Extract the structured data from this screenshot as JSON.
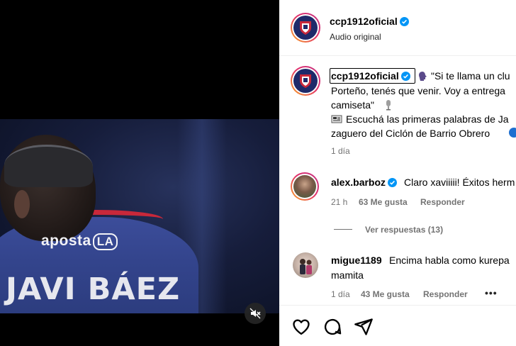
{
  "media": {
    "sponsor_text": "aposta",
    "sponsor_box_text": "LA",
    "jersey_name": "JAVI BÁEZ",
    "mute_icon": "speaker-muted-icon"
  },
  "header": {
    "username": "ccp1912oficial",
    "audio_label": "Audio original"
  },
  "caption": {
    "username": "ccp1912oficial",
    "line1": "\"Si te llama un clu",
    "line2": "Porteño, tenés que venir. Voy a entrega",
    "line3": "camiseta\"",
    "line4": "Escuchá las primeras palabras de Ja",
    "line5": "zaguero del Ciclón de Barrio Obrero",
    "time": "1 día"
  },
  "comments": [
    {
      "username": "alex.barboz",
      "text": "Claro xaviiiii! Éxitos herm",
      "time": "21 h",
      "likes": "63 Me gusta",
      "reply": "Responder",
      "view_replies": "Ver respuestas (13)"
    },
    {
      "username": "migue1189",
      "text": "Encima habla como kurepa",
      "text2": "mamita",
      "time": "1 día",
      "likes": "43 Me gusta",
      "reply": "Responder",
      "more": "•••"
    }
  ],
  "actions": [
    "heart-icon",
    "comment-icon",
    "share-icon"
  ],
  "colors": {
    "verified": "#0095f6",
    "club_blue": "#1e2a6a",
    "club_red": "#c8283a"
  }
}
